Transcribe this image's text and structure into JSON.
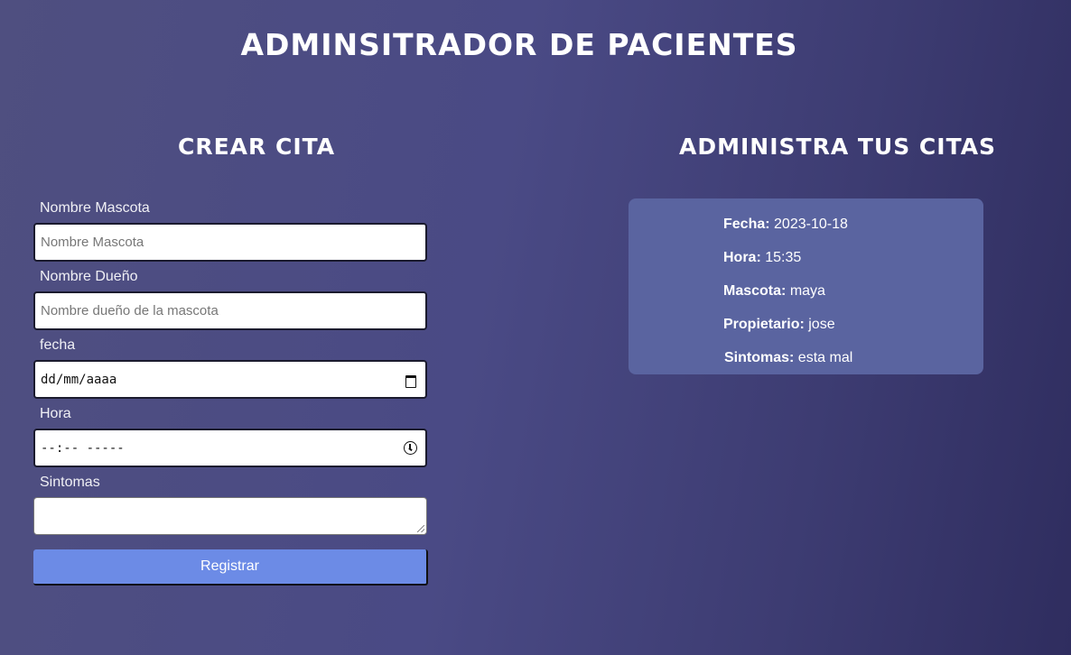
{
  "header": {
    "title": "ADMINSITRADOR DE PACIENTES"
  },
  "form_section": {
    "title": "CREAR CITA",
    "pet_name": {
      "label": "Nombre Mascota",
      "placeholder": "Nombre Mascota"
    },
    "owner_name": {
      "label": "Nombre Dueño",
      "placeholder": "Nombre dueño de la mascota"
    },
    "date": {
      "label": "fecha",
      "placeholder": "dd/mm/aaaa",
      "icon": "calendar-icon"
    },
    "time": {
      "label": "Hora",
      "placeholder": "--:-- -----",
      "icon": "clock-icon"
    },
    "symptoms": {
      "label": "Sintomas",
      "value": ""
    },
    "submit_label": "Registrar"
  },
  "appointments_section": {
    "title": "ADMINISTRA TUS CITAS",
    "appointments": [
      {
        "fecha_label": "Fecha:",
        "fecha": "2023-10-18",
        "hora_label": "Hora:",
        "hora": "15:35",
        "mascota_label": "Mascota:",
        "mascota": "maya",
        "propietario_label": "Propietario:",
        "propietario": "jose",
        "sintomas_label": "Sintomas:",
        "sintomas": "esta mal"
      }
    ]
  },
  "colors": {
    "background_start": "#4f4f80",
    "background_end": "#2f2d5f",
    "card": "#5a64a0",
    "button": "#6c8be6"
  }
}
